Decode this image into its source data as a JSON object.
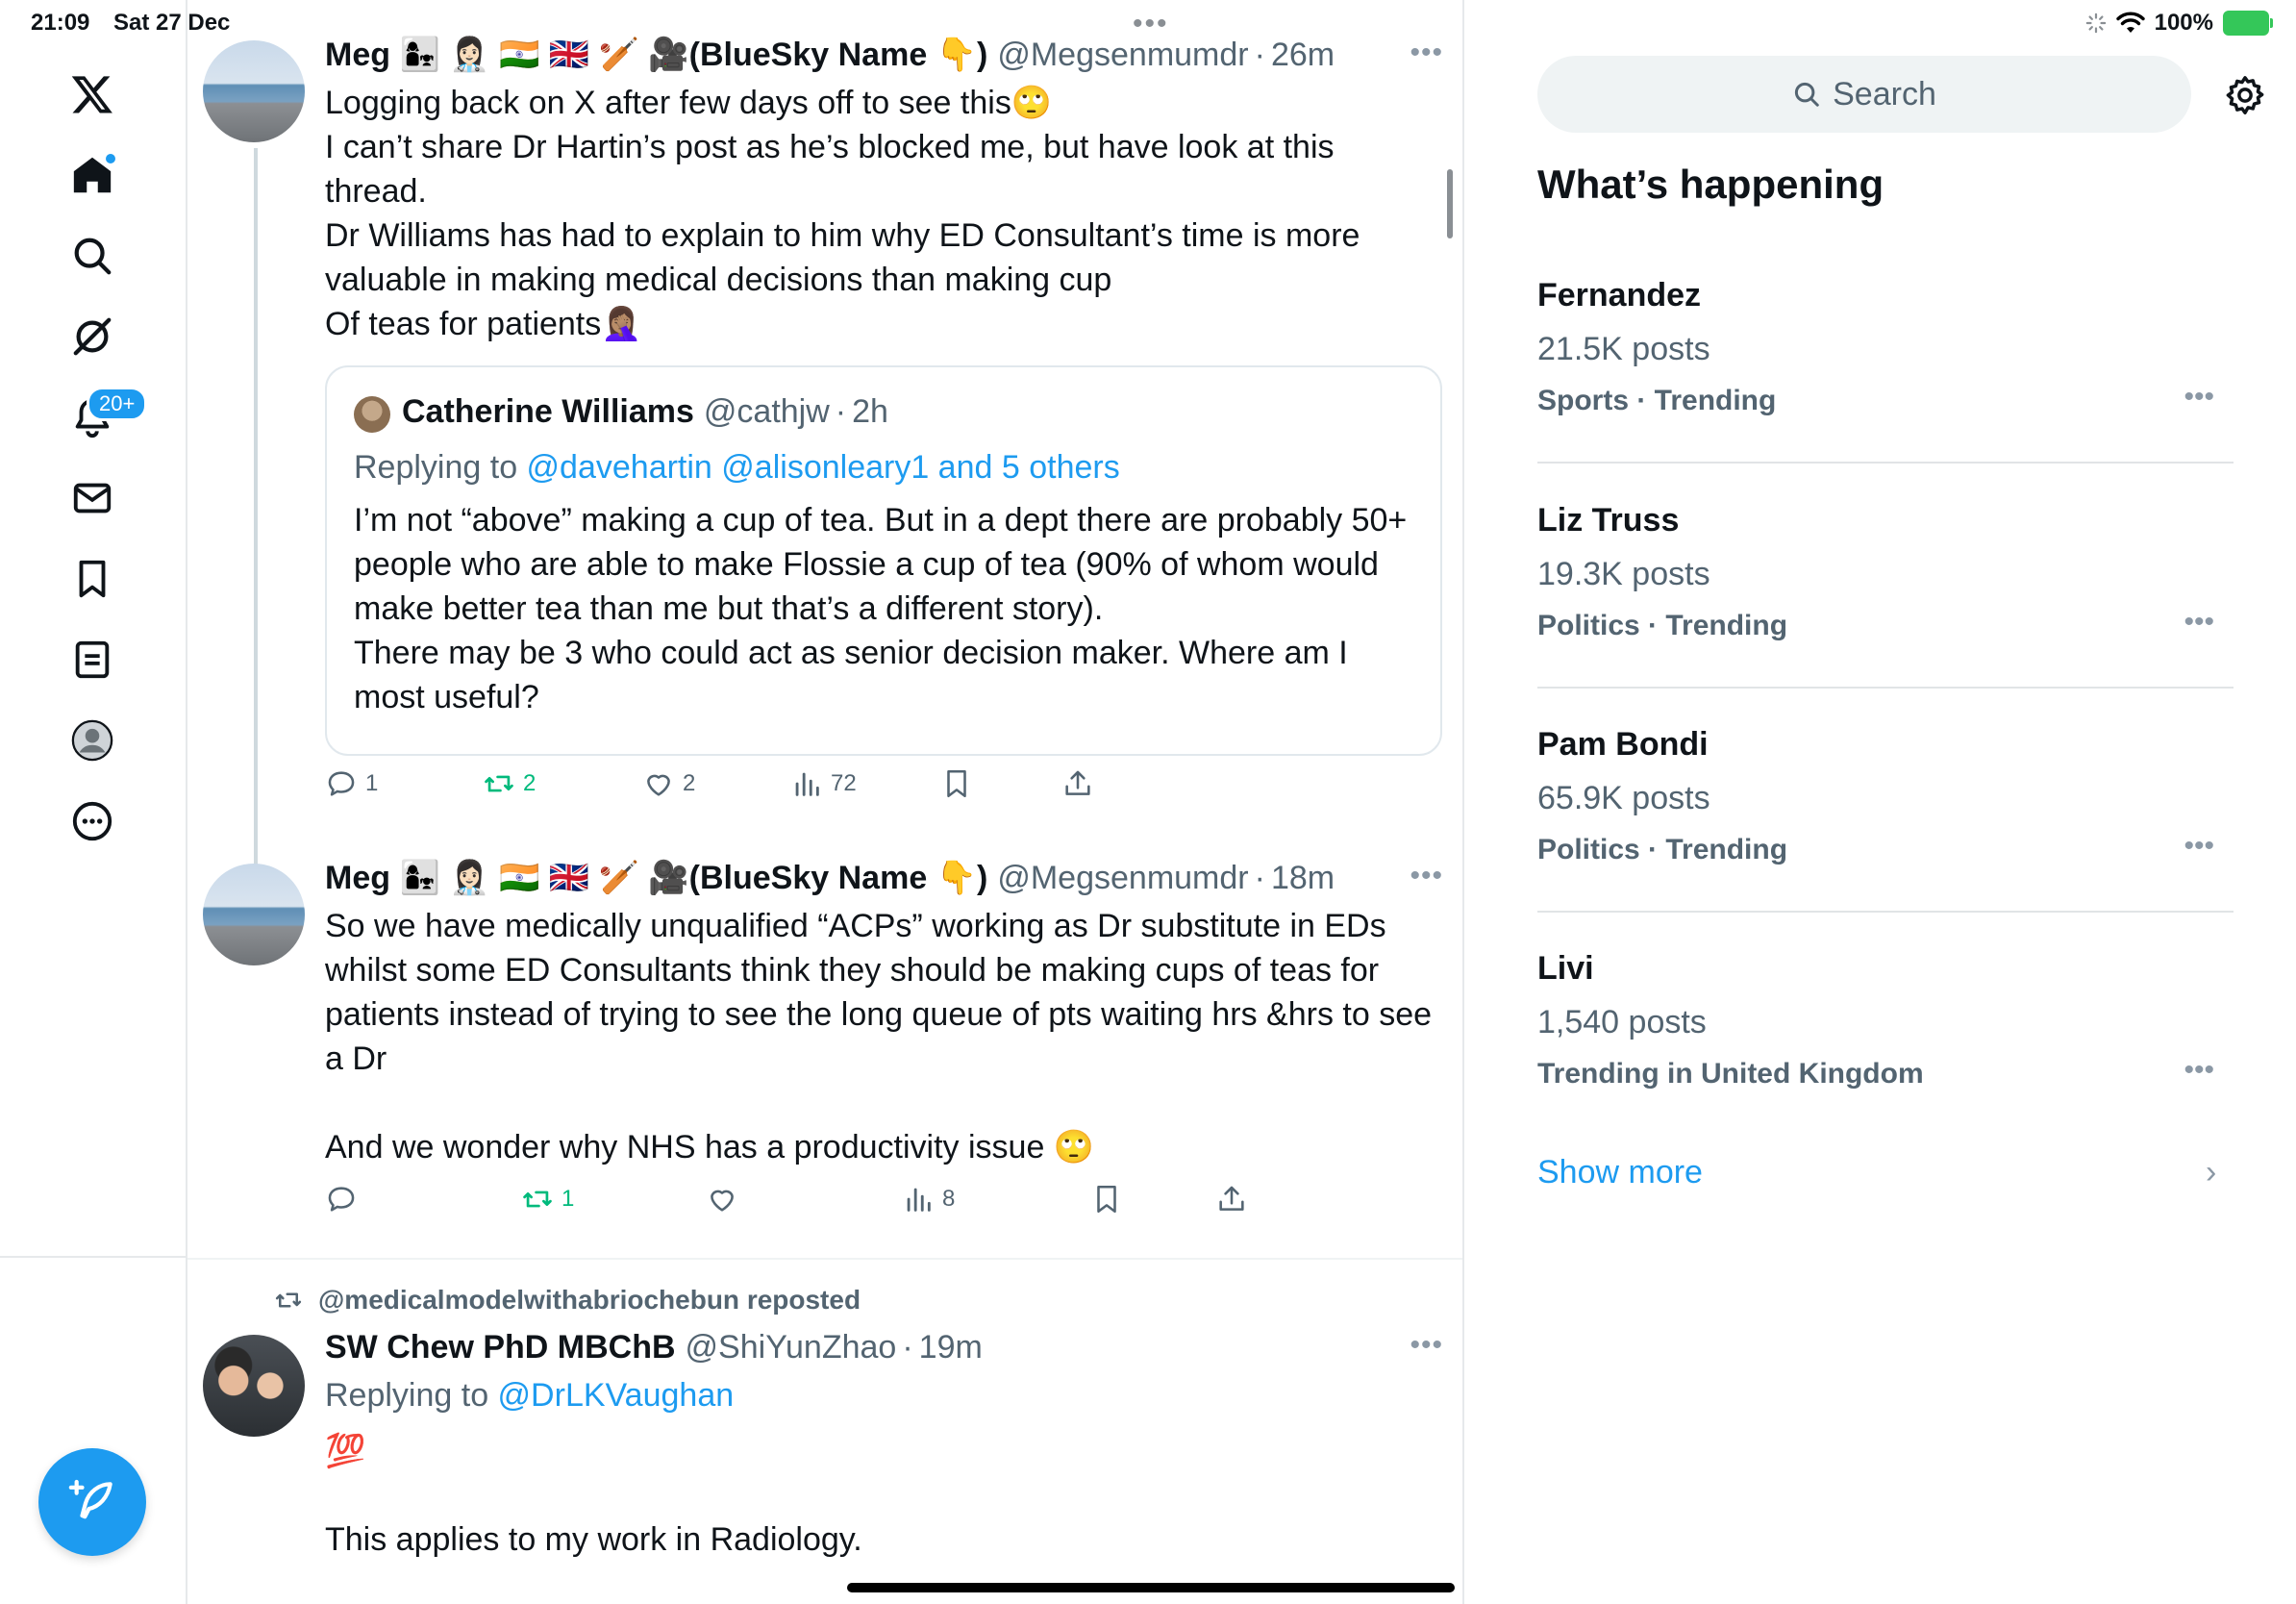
{
  "status_bar": {
    "time": "21:09",
    "date": "Sat 27 Dec",
    "battery": "100%"
  },
  "top_dots": "•••",
  "nav": {
    "notifications_badge": "20+"
  },
  "tweets": [
    {
      "display_name": "Meg 👩‍👧 👩🏻‍⚕️ 🇮🇳 🇬🇧 🏏 🎥(BlueSky Name 👇)",
      "handle": "@Megsenmumdr",
      "time": "26m",
      "text": "Logging back on X after few days off to see this🙄\nI can’t share Dr Hartin’s post as he’s blocked me, but have look at this thread.\nDr Williams has had to explain to him why ED Consultant’s time is more valuable in making medical decisions than making cup\nOf teas for patients🤦🏽‍♀️",
      "quote": {
        "display_name": "Catherine Williams",
        "handle": "@cathjw",
        "time": "2h",
        "replying_prefix": "Replying to ",
        "replying_to": "@davehartin @alisonleary1 and 5 others",
        "text": "I’m not “above” making a cup of tea. But in a dept there are probably 50+ people who are able to make Flossie a cup of tea (90% of whom would make better tea than me but that’s a different story).\nThere may be 3 who could act as senior decision maker. Where am I most useful?"
      },
      "stats": {
        "replies": "1",
        "reposts": "2",
        "likes": "2",
        "views": "72"
      }
    },
    {
      "display_name": "Meg 👩‍👧 👩🏻‍⚕️ 🇮🇳 🇬🇧 🏏 🎥(BlueSky Name 👇)",
      "handle": "@Megsenmumdr",
      "time": "18m",
      "text": "So we have medically unqualified “ACPs” working as Dr substitute in EDs whilst some ED Consultants think they should be making cups of teas for patients instead of trying to see the long queue of pts waiting hrs &hrs to see a Dr\n\nAnd we wonder why NHS has a productivity issue 🙄",
      "stats": {
        "replies": "",
        "reposts": "1",
        "likes": "",
        "views": "8"
      }
    },
    {
      "repost_label": "@medicalmodelwithabriochebun reposted",
      "display_name": "SW Chew PhD MBChB",
      "handle": "@ShiYunZhao",
      "time": "19m",
      "replying_prefix": "Replying to ",
      "replying_to": "@DrLKVaughan",
      "text": "💯\n\nThis applies to my work in Radiology."
    }
  ],
  "sidebar": {
    "search_placeholder": "Search",
    "trends_title": "What’s happening",
    "trends": [
      {
        "name": "Fernandez",
        "count": "21.5K posts",
        "context": "Sports · Trending"
      },
      {
        "name": "Liz Truss",
        "count": "19.3K posts",
        "context": "Politics · Trending"
      },
      {
        "name": "Pam Bondi",
        "count": "65.9K posts",
        "context": "Politics · Trending"
      },
      {
        "name": "Livi",
        "count": "1,540 posts",
        "context": "Trending in United Kingdom"
      }
    ],
    "show_more": "Show more",
    "more_dots": "•••",
    "sep": "·"
  },
  "colors": {
    "accent": "#1d9bf0",
    "repost_green": "#00ba7c",
    "secondary_text": "#536471"
  }
}
